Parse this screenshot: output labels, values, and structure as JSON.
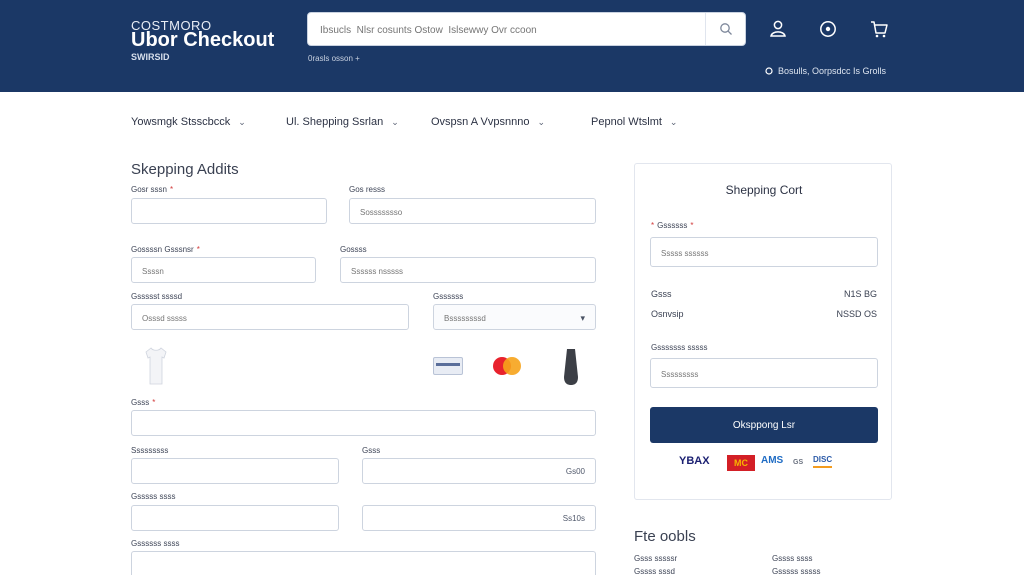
{
  "header": {
    "brand_small": "COSTMORO",
    "brand_title": "Ubor Checkout",
    "brand_sub": "SWIRSID",
    "search_placeholder": "Ibsucls  Nlsr cosunts Ostow  Islsewwy Ovr ccoon",
    "search_hint": "0rasls   osson   +",
    "status_text": "Bosulls, Oorpsdcc Is Grolls",
    "icons": [
      "user-icon",
      "info-icon",
      "cart-icon"
    ]
  },
  "steps": [
    {
      "label": "Yowsmgk Stsscbcck"
    },
    {
      "label": "Ul. Shepping Ssrlan"
    },
    {
      "label": "Ovspsn A Vvpsnnno"
    },
    {
      "label": "Pepnol Wtslmt"
    }
  ],
  "form": {
    "section_title": "Skepping Addits",
    "fields": [
      {
        "label": "Gosr sssn",
        "required": true,
        "placeholder": ""
      },
      {
        "label": "Gos resss",
        "required": false,
        "placeholder": "Sossssssso"
      },
      {
        "label": "Gossssn Gsssnsr",
        "required": true,
        "placeholder": "Ssssn"
      },
      {
        "label": "Gossss",
        "required": false,
        "placeholder": "Ssssss nsssss"
      },
      {
        "label": "Gssssst ssssd",
        "required": false,
        "placeholder": "Osssd sssss"
      },
      {
        "label": "Gssssss",
        "required": false,
        "placeholder": "Bssssssssd"
      },
      {
        "label": "Gsss",
        "required": true,
        "placeholder": ""
      },
      {
        "label": "Sssssssss",
        "required": false,
        "placeholder": ""
      },
      {
        "label": "Gsss",
        "required": false,
        "placeholder": "",
        "value": "Gs00"
      },
      {
        "label": "Gsssss ssss",
        "required": false,
        "placeholder": ""
      },
      {
        "label": "",
        "required": false,
        "placeholder": "",
        "value": "Ss10s"
      },
      {
        "label": "Gssssss ssss",
        "required": false,
        "placeholder": ""
      }
    ]
  },
  "cart": {
    "title": "Shepping Cort",
    "coupon_label": "Gssssss",
    "coupon_placeholder": "Sssss ssssss",
    "rows": [
      {
        "label": "Gsss",
        "value": "N1S BG"
      },
      {
        "label": "Osnvsip",
        "value": "NSSD OS"
      }
    ],
    "note_label": "Gsssssss sssss",
    "note_placeholder": "Sssssssss",
    "checkout_label": "Oksppong  Lsr",
    "payment_logos": [
      "YBAX",
      "MC",
      "AMS",
      "GS",
      "DISC"
    ]
  },
  "totals": {
    "title": "Fte oobls",
    "rows": [
      {
        "label": "Gsss sssssr",
        "value": "Gssss ssss"
      },
      {
        "label": "Gssss sssd",
        "value": "Gsssss sssss"
      }
    ]
  },
  "colors": {
    "brand": "#1b3866",
    "required": "#d23b3b"
  }
}
